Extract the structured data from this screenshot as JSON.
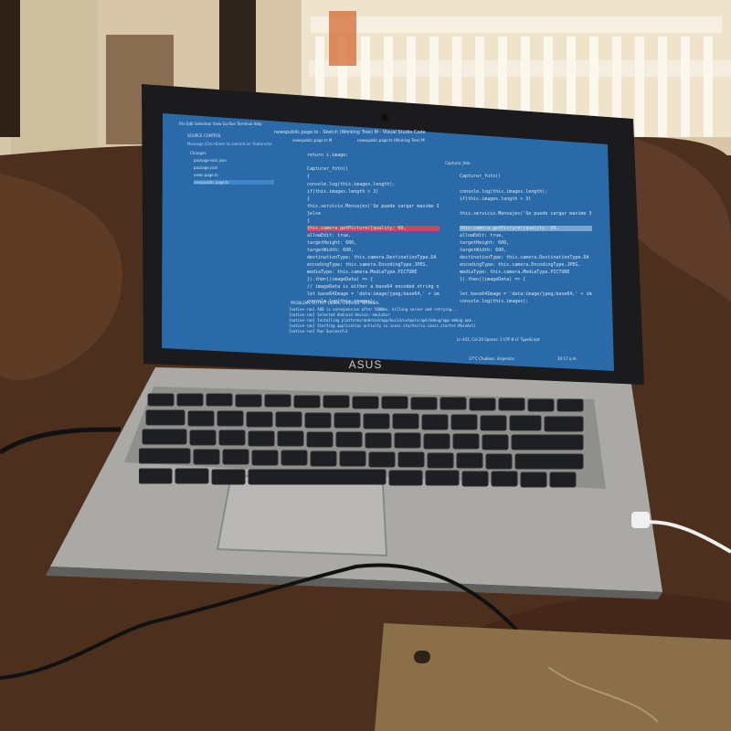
{
  "screen": {
    "window_title": "newspublic.page.ts - Sketch (Working Tree) M - Visual Studio Code",
    "menu": [
      "File",
      "Edit",
      "Selection",
      "View",
      "Go",
      "Run",
      "Terminal",
      "Help"
    ],
    "source_control": {
      "title": "SOURCE CONTROL",
      "message_placeholder": "Message (Ctrl+Enter to commit on 'feature/ne",
      "changes_label": "Changes",
      "files": [
        "package-lock.json",
        "package.json",
        "news.page.ts",
        "newspublic.page.ts"
      ]
    },
    "tabs": [
      "newspublic.page.ts M",
      "newspublic.page.ts (Working Tree) M",
      "Capturar_foto"
    ],
    "code_lines": [
      "return i.image;",
      "",
      "Capturar_foto()",
      "{",
      "  console.log(this.images.length);",
      "  if(this.images.length > 3)",
      "  {",
      "    this.servicio.Mensajes('Se puede cargar maximo 3",
      "  }else",
      "  {",
      "    this.camera.getPicture({quality: 60,",
      "      allowEdit: true,",
      "      targetHeight: 600,",
      "      targetWidth: 600,",
      "      destinationType: this.camera.DestinationType.DA",
      "      encodingType: this.camera.EncodingType.JPEG,",
      "      mediaType: this.camera.MediaType.PICTURE",
      "    }).then((imageData) => {",
      "      // imageData is either a base64 encoded string or",
      "      let base64Image = 'data:image/jpeg;base64,' + image",
      "      console.log(this.images);"
    ],
    "right_code_lines": [
      "Capturar_foto()",
      "",
      "  console.log(this.images.length);",
      "  if(this.images.length > 3)",
      "",
      "  this.servicio.Mensajes('Se puede cargar maximo 3",
      "",
      "  this.camera.getPicture({quality: 60,",
      "    allowEdit: true,",
      "    targetHeight: 600,",
      "    targetWidth: 600,",
      "    destinationType: this.camera.DestinationType.DA",
      "    encodingType: this.camera.EncodingType.JPEG,",
      "    mediaType: this.camera.MediaType.PICTURE",
      "  }).then((imageData) => {",
      "",
      "  let base64Image = 'data:image/jpeg;base64,' + image",
      "  console.log(this.images);"
    ],
    "panel_tabs": [
      "PROBLEMS",
      "OUTPUT",
      "DEBUG CONSOLE",
      "TERMINAL"
    ],
    "terminal_lines": [
      "[native-run] ADB is unresponsive after 5000ms, killing server and retrying...",
      "[native-run] Selected Android device: emulator",
      "[native-run] Installing platforms/android/app/build/outputs/apk/debug/app-debug.apk...",
      "[native-run] Starting application activity io.ionic.starter/io.ionic.starter.MainActivity...",
      "[native-run] Run Successful"
    ],
    "status_bar": "Ln 441, Col 20  Spaces: 2  UTF-8  LF  TypeScript",
    "taskbar_clock": "10:17 a.m.",
    "taskbar_weather": "17°C  Chubasc. dispersos"
  },
  "brand": "ASUS",
  "colors": {
    "screen_bg": "#2a6aa8",
    "editor_bg": "#2e78b9",
    "sidebar_bg": "#2566a0",
    "taskbar_bg": "#1a3e63",
    "laptop_silver": "#a7a6a3",
    "bed_brown": "#4d2f1d",
    "wood": "#8a6f49"
  }
}
